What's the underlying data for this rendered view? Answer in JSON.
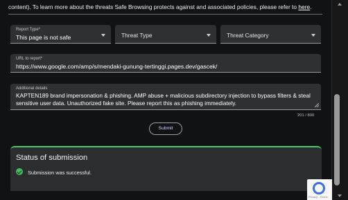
{
  "intro": {
    "text": "content). To learn more about the threats Safe Browsing protects against and associated policies, please refer to ",
    "link_label": "here",
    "after": "."
  },
  "fields": {
    "report_type": {
      "label": "Report Type*",
      "value": "This page is not safe"
    },
    "threat_type": {
      "placeholder": "Threat Type"
    },
    "threat_category": {
      "placeholder": "Threat Category"
    },
    "url": {
      "label": "URL to report*",
      "value": "https://www.google.com/amp/s/mendaki-gunung-tertinggi.pages.dev/gascek/"
    },
    "details": {
      "label": "Additional details",
      "value": "KAPTEN189 brand impersonation & phishing. AMP abuse + malicious subdirectory injection to bypass filters & steal sensitive user data. Unauthorized fake site. Please report this as phishing immediately."
    }
  },
  "counter": "201 / 800",
  "submit_label": "Submit",
  "status": {
    "title": "Status of submission",
    "message": "Submission was successful."
  },
  "recaptcha": {
    "text": "Privacy - Terms"
  },
  "colors": {
    "accent_success": "#3fcf6a",
    "submit_text": "#c5d4ff"
  },
  "icons": [
    "chevron-down-icon",
    "check-circle-icon",
    "recaptcha-logo-icon",
    "resize-handle-icon"
  ]
}
